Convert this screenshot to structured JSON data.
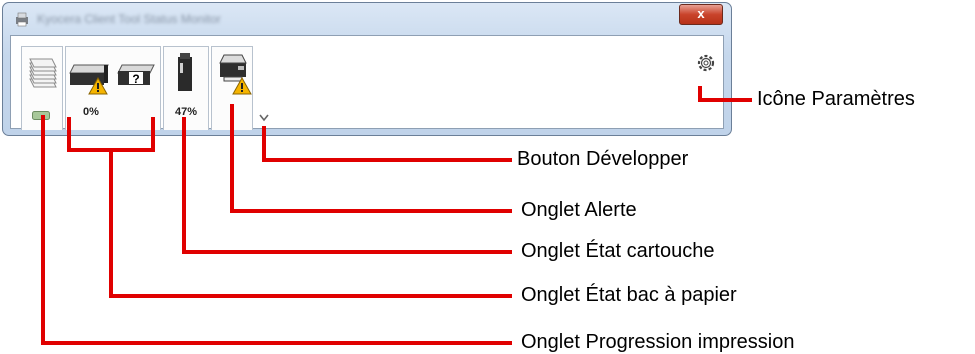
{
  "window": {
    "title": "Kyocera Client Tool Status Monitor",
    "close_glyph": "x"
  },
  "tabs": {
    "paper_level": "0%",
    "toner_level": "47%"
  },
  "icons": {
    "app": "printer-app-icon",
    "progress": "stacked-pages-icon",
    "paper_tray": "paper-tray-icon",
    "unknown_tray": "question-mark-tray-icon",
    "warning": "warning-triangle-icon",
    "toner": "toner-cartridge-icon",
    "mfp": "printer-mfp-icon",
    "expand": "chevron-down-icon",
    "settings": "gear-icon"
  },
  "labels": {
    "settings_icon": "Icône Paramètres",
    "expand_button": "Bouton Développer",
    "alert_tab": "Onglet Alerte",
    "toner_tab": "Onglet État cartouche",
    "paper_tab": "Onglet État bac à papier",
    "progress_tab": "Onglet Progression impression"
  },
  "colors": {
    "callout": "#e00000",
    "warning": "#f5b400",
    "close": "#c9432b"
  }
}
